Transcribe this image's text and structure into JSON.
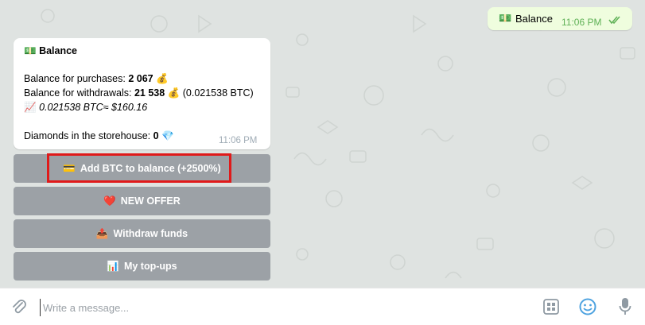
{
  "outgoing": {
    "emoji": "💵",
    "text": "Balance",
    "time": "11:06 PM"
  },
  "incoming": {
    "title_emoji": "💵",
    "title": "Balance",
    "purchases_label": "Balance for purchases: ",
    "purchases_value": "2 067",
    "money_bag": "💰",
    "withdrawals_label": "Balance for withdrawals: ",
    "withdrawals_value": "21 538",
    "withdrawals_btc": "(0.021538 BTC)",
    "chart_emoji": "📈",
    "btc_rate": "0.021538 BTC≈ $160.16",
    "diamonds_label": "Diamonds in the storehouse: ",
    "diamonds_value": "0",
    "diamond_emoji": "💎",
    "time": "11:06 PM"
  },
  "keyboard": {
    "buttons": [
      {
        "emoji": "💳",
        "label": "Add BTC to balance (+2500%)"
      },
      {
        "emoji": "❤️",
        "label": "NEW OFFER"
      },
      {
        "emoji": "📤",
        "label": "Withdraw funds"
      },
      {
        "emoji": "📊",
        "label": "My top-ups"
      }
    ]
  },
  "composer": {
    "placeholder": "Write a message..."
  },
  "icons": {
    "attach": "paperclip-icon",
    "commands": "bot-commands-icon",
    "emoji": "smiley-icon",
    "mic": "microphone-icon"
  },
  "colors": {
    "outgoing_bubble": "#effdde",
    "read_checks": "#5fb156",
    "keyboard_button": "#7d858e",
    "highlight": "#e01a1a",
    "emoji_accent": "#4fa3e0"
  }
}
